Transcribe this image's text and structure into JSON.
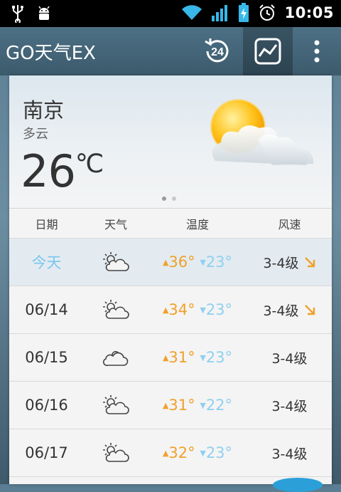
{
  "status_bar": {
    "time": "10:05",
    "icons": [
      "usb-icon",
      "android-debug-icon",
      "wifi-icon",
      "signal-icon",
      "battery-charging-icon",
      "alarm-icon"
    ]
  },
  "app_bar": {
    "title": "GO天气EX",
    "hours_button_label": "24"
  },
  "current": {
    "city": "南京",
    "condition": "多云",
    "temperature": "26",
    "unit": "℃",
    "page_count": 2,
    "active_page": 0
  },
  "forecast": {
    "headers": {
      "date": "日期",
      "weather": "天气",
      "temp": "温度",
      "wind": "风速"
    },
    "rows": [
      {
        "date": "今天",
        "icon": "partly-cloudy-icon",
        "high": "36°",
        "low": "23°",
        "wind": "3-4级",
        "wind_arrow": true
      },
      {
        "date": "06/14",
        "icon": "partly-cloudy-icon",
        "high": "34°",
        "low": "23°",
        "wind": "3-4级",
        "wind_arrow": true
      },
      {
        "date": "06/15",
        "icon": "cloudy-icon",
        "high": "31°",
        "low": "23°",
        "wind": "3-4级",
        "wind_arrow": false
      },
      {
        "date": "06/16",
        "icon": "partly-cloudy-icon",
        "high": "31°",
        "low": "22°",
        "wind": "3-4级",
        "wind_arrow": false
      },
      {
        "date": "06/17",
        "icon": "partly-cloudy-icon",
        "high": "32°",
        "low": "23°",
        "wind": "3-4级",
        "wind_arrow": false
      }
    ],
    "colors": {
      "high": "#f0a12a",
      "low": "#8fd0f0",
      "today": "#7cc6ee",
      "wind_arrow": "#f0a12a"
    }
  }
}
